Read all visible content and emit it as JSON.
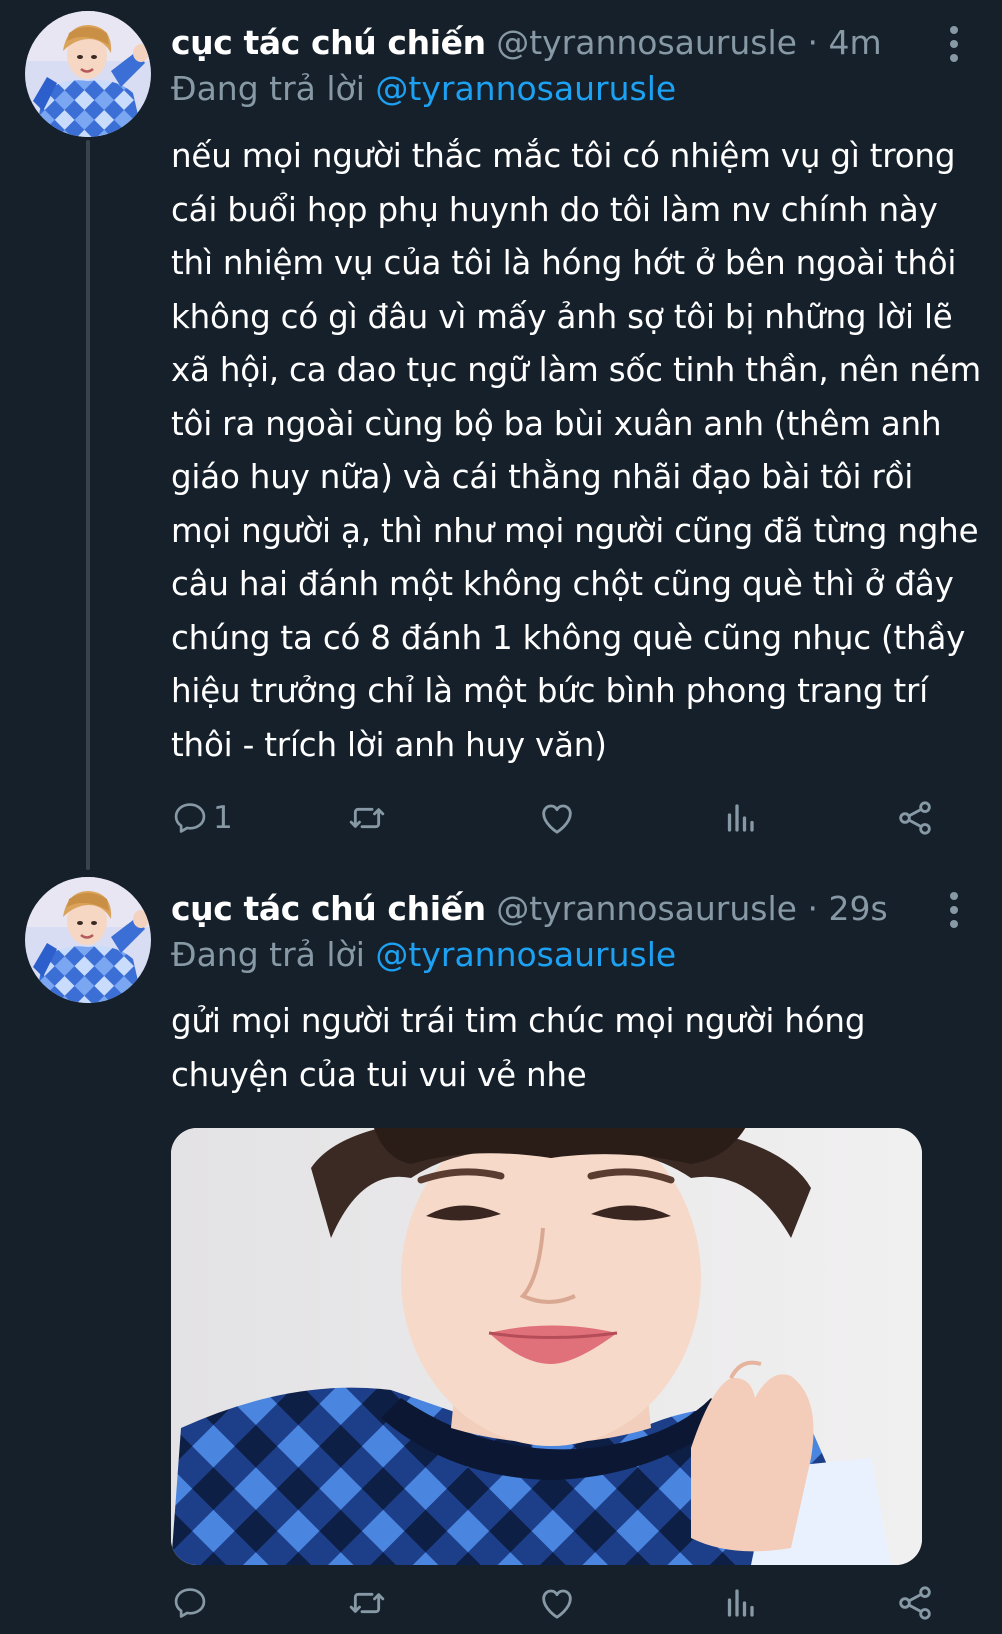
{
  "tweets": [
    {
      "display_name": "cục tác chú chiến",
      "handle": "@tyrannosaurusle",
      "separator": "·",
      "time": "4m",
      "reply_prefix": "Đang trả lời",
      "reply_mention": "@tyrannosaurusle",
      "text": "nếu mọi người thắc mắc tôi có nhiệm vụ gì trong cái buổi họp phụ huynh do tôi làm nv chính này thì nhiệm vụ của tôi là hóng hớt ở bên ngoài thôi không có gì đâu vì mấy ảnh sợ tôi bị những lời lẽ xã hội, ca dao tục ngữ làm sốc tinh thần, nên ném tôi ra ngoài cùng bộ ba bùi xuân anh (thêm anh giáo huy nữa) và cái thằng nhãi đạo bài tôi rồi mọi người ạ, thì như mọi người cũng đã từng nghe câu hai đánh một không chột cũng què thì ở đây chúng ta có 8 đánh 1 không què cũng nhục (thầy hiệu trưởng chỉ là một bức bình phong trang trí thôi - trích lời anh huy văn)",
      "reply_count": "1",
      "icons": {
        "reply": "reply-icon",
        "retweet": "retweet-icon",
        "like": "heart-icon",
        "analytics": "analytics-icon",
        "share": "share-icon",
        "more": "more-vertical-icon"
      }
    },
    {
      "display_name": "cục tác chú chiến",
      "handle": "@tyrannosaurusle",
      "separator": "·",
      "time": "29s",
      "reply_prefix": "Đang trả lời",
      "reply_mention": "@tyrannosaurusle",
      "text": "gửi mọi người trái tim chúc mọi người hóng chuyện của tui vui vẻ nhe",
      "reply_count": "",
      "icons": {
        "reply": "reply-icon",
        "retweet": "retweet-icon",
        "like": "heart-icon",
        "analytics": "analytics-icon",
        "share": "share-icon",
        "more": "more-vertical-icon"
      }
    }
  ],
  "colors": {
    "background": "#15202b",
    "text_primary": "#ffffff",
    "text_secondary": "#8899a6",
    "link": "#1da1f2",
    "thread_line": "#38444d"
  }
}
